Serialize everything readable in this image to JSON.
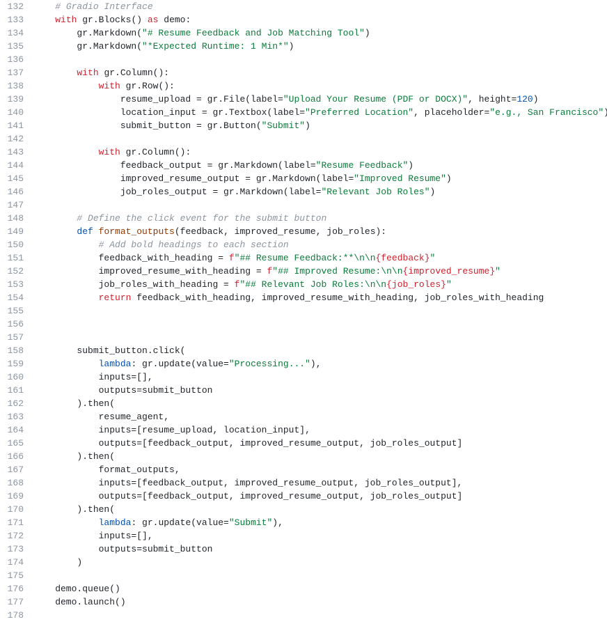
{
  "lines": [
    {
      "n": 132,
      "segs": [
        {
          "t": "    ",
          "k": "op"
        },
        {
          "t": "# Gradio Interface",
          "k": "c"
        }
      ]
    },
    {
      "n": 133,
      "segs": [
        {
          "t": "    ",
          "k": "op"
        },
        {
          "t": "with",
          "k": "kw"
        },
        {
          "t": " gr.Blocks() ",
          "k": "id"
        },
        {
          "t": "as",
          "k": "kw"
        },
        {
          "t": " demo:",
          "k": "id"
        }
      ]
    },
    {
      "n": 134,
      "segs": [
        {
          "t": "        gr.Markdown(",
          "k": "id"
        },
        {
          "t": "\"# Resume Feedback and Job Matching Tool\"",
          "k": "st"
        },
        {
          "t": ")",
          "k": "id"
        }
      ]
    },
    {
      "n": 135,
      "segs": [
        {
          "t": "        gr.Markdown(",
          "k": "id"
        },
        {
          "t": "\"*Expected Runtime: 1 Min*\"",
          "k": "st"
        },
        {
          "t": ")",
          "k": "id"
        }
      ]
    },
    {
      "n": 136,
      "segs": []
    },
    {
      "n": 137,
      "segs": [
        {
          "t": "        ",
          "k": "op"
        },
        {
          "t": "with",
          "k": "kw"
        },
        {
          "t": " gr.Column():",
          "k": "id"
        }
      ]
    },
    {
      "n": 138,
      "segs": [
        {
          "t": "            ",
          "k": "op"
        },
        {
          "t": "with",
          "k": "kw"
        },
        {
          "t": " gr.Row():",
          "k": "id"
        }
      ]
    },
    {
      "n": 139,
      "segs": [
        {
          "t": "                resume_upload = gr.File(label=",
          "k": "id"
        },
        {
          "t": "\"Upload Your Resume (PDF or DOCX)\"",
          "k": "st"
        },
        {
          "t": ", height=",
          "k": "id"
        },
        {
          "t": "120",
          "k": "nm"
        },
        {
          "t": ")",
          "k": "id"
        }
      ]
    },
    {
      "n": 140,
      "segs": [
        {
          "t": "                location_input = gr.Textbox(label=",
          "k": "id"
        },
        {
          "t": "\"Preferred Location\"",
          "k": "st"
        },
        {
          "t": ", placeholder=",
          "k": "id"
        },
        {
          "t": "\"e.g., San Francisco\"",
          "k": "st"
        },
        {
          "t": ")",
          "k": "id"
        }
      ]
    },
    {
      "n": 141,
      "segs": [
        {
          "t": "                submit_button = gr.Button(",
          "k": "id"
        },
        {
          "t": "\"Submit\"",
          "k": "st"
        },
        {
          "t": ")",
          "k": "id"
        }
      ]
    },
    {
      "n": 142,
      "segs": []
    },
    {
      "n": 143,
      "segs": [
        {
          "t": "            ",
          "k": "op"
        },
        {
          "t": "with",
          "k": "kw"
        },
        {
          "t": " gr.Column():",
          "k": "id"
        }
      ]
    },
    {
      "n": 144,
      "segs": [
        {
          "t": "                feedback_output = gr.Markdown(label=",
          "k": "id"
        },
        {
          "t": "\"Resume Feedback\"",
          "k": "st"
        },
        {
          "t": ")",
          "k": "id"
        }
      ]
    },
    {
      "n": 145,
      "segs": [
        {
          "t": "                improved_resume_output = gr.Markdown(label=",
          "k": "id"
        },
        {
          "t": "\"Improved Resume\"",
          "k": "st"
        },
        {
          "t": ")",
          "k": "id"
        }
      ]
    },
    {
      "n": 146,
      "segs": [
        {
          "t": "                job_roles_output = gr.Markdown(label=",
          "k": "id"
        },
        {
          "t": "\"Relevant Job Roles\"",
          "k": "st"
        },
        {
          "t": ")",
          "k": "id"
        }
      ]
    },
    {
      "n": 147,
      "segs": []
    },
    {
      "n": 148,
      "segs": [
        {
          "t": "        ",
          "k": "op"
        },
        {
          "t": "# Define the click event for the submit button",
          "k": "c"
        }
      ]
    },
    {
      "n": 149,
      "segs": [
        {
          "t": "        ",
          "k": "op"
        },
        {
          "t": "def",
          "k": "kw2"
        },
        {
          "t": " ",
          "k": "op"
        },
        {
          "t": "format_outputs",
          "k": "fnd"
        },
        {
          "t": "(feedback, improved_resume, job_roles):",
          "k": "id"
        }
      ]
    },
    {
      "n": 150,
      "segs": [
        {
          "t": "            ",
          "k": "op"
        },
        {
          "t": "# Add bold headings to each section",
          "k": "c"
        }
      ]
    },
    {
      "n": 151,
      "segs": [
        {
          "t": "            feedback_with_heading = ",
          "k": "id"
        },
        {
          "t": "f",
          "k": "kw"
        },
        {
          "t": "\"## Resume Feedback:**\\n\\n",
          "k": "st"
        },
        {
          "t": "{feedback}",
          "k": "sf"
        },
        {
          "t": "\"",
          "k": "st"
        }
      ]
    },
    {
      "n": 152,
      "segs": [
        {
          "t": "            improved_resume_with_heading = ",
          "k": "id"
        },
        {
          "t": "f",
          "k": "kw"
        },
        {
          "t": "\"## Improved Resume:\\n\\n",
          "k": "st"
        },
        {
          "t": "{improved_resume}",
          "k": "sf"
        },
        {
          "t": "\"",
          "k": "st"
        }
      ]
    },
    {
      "n": 153,
      "segs": [
        {
          "t": "            job_roles_with_heading = ",
          "k": "id"
        },
        {
          "t": "f",
          "k": "kw"
        },
        {
          "t": "\"## Relevant Job Roles:\\n\\n",
          "k": "st"
        },
        {
          "t": "{job_roles}",
          "k": "sf"
        },
        {
          "t": "\"",
          "k": "st"
        }
      ]
    },
    {
      "n": 154,
      "segs": [
        {
          "t": "            ",
          "k": "op"
        },
        {
          "t": "return",
          "k": "kw"
        },
        {
          "t": " feedback_with_heading, improved_resume_with_heading, job_roles_with_heading",
          "k": "id"
        }
      ]
    },
    {
      "n": 155,
      "segs": []
    },
    {
      "n": 156,
      "segs": []
    },
    {
      "n": 157,
      "segs": []
    },
    {
      "n": 158,
      "segs": [
        {
          "t": "        submit_button.click(",
          "k": "id"
        }
      ]
    },
    {
      "n": 159,
      "segs": [
        {
          "t": "            ",
          "k": "op"
        },
        {
          "t": "lambda",
          "k": "kw2"
        },
        {
          "t": ": gr.update(value=",
          "k": "id"
        },
        {
          "t": "\"Processing...\"",
          "k": "st"
        },
        {
          "t": "),",
          "k": "id"
        }
      ]
    },
    {
      "n": 160,
      "segs": [
        {
          "t": "            inputs=[],",
          "k": "id"
        }
      ]
    },
    {
      "n": 161,
      "segs": [
        {
          "t": "            outputs=submit_button",
          "k": "id"
        }
      ]
    },
    {
      "n": 162,
      "segs": [
        {
          "t": "        ).then(",
          "k": "id"
        }
      ]
    },
    {
      "n": 163,
      "segs": [
        {
          "t": "            resume_agent,",
          "k": "id"
        }
      ]
    },
    {
      "n": 164,
      "segs": [
        {
          "t": "            inputs=[resume_upload, location_input],",
          "k": "id"
        }
      ]
    },
    {
      "n": 165,
      "segs": [
        {
          "t": "            outputs=[feedback_output, improved_resume_output, job_roles_output]",
          "k": "id"
        }
      ]
    },
    {
      "n": 166,
      "segs": [
        {
          "t": "        ).then(",
          "k": "id"
        }
      ]
    },
    {
      "n": 167,
      "segs": [
        {
          "t": "            format_outputs,",
          "k": "id"
        }
      ]
    },
    {
      "n": 168,
      "segs": [
        {
          "t": "            inputs=[feedback_output, improved_resume_output, job_roles_output],",
          "k": "id"
        }
      ]
    },
    {
      "n": 169,
      "segs": [
        {
          "t": "            outputs=[feedback_output, improved_resume_output, job_roles_output]",
          "k": "id"
        }
      ]
    },
    {
      "n": 170,
      "segs": [
        {
          "t": "        ).then(",
          "k": "id"
        }
      ]
    },
    {
      "n": 171,
      "segs": [
        {
          "t": "            ",
          "k": "op"
        },
        {
          "t": "lambda",
          "k": "kw2"
        },
        {
          "t": ": gr.update(value=",
          "k": "id"
        },
        {
          "t": "\"Submit\"",
          "k": "st"
        },
        {
          "t": "),",
          "k": "id"
        }
      ]
    },
    {
      "n": 172,
      "segs": [
        {
          "t": "            inputs=[],",
          "k": "id"
        }
      ]
    },
    {
      "n": 173,
      "segs": [
        {
          "t": "            outputs=submit_button",
          "k": "id"
        }
      ]
    },
    {
      "n": 174,
      "segs": [
        {
          "t": "        )",
          "k": "id"
        }
      ]
    },
    {
      "n": 175,
      "segs": []
    },
    {
      "n": 176,
      "segs": [
        {
          "t": "    demo.queue()",
          "k": "id"
        }
      ]
    },
    {
      "n": 177,
      "segs": [
        {
          "t": "    demo.launch()",
          "k": "id"
        }
      ]
    },
    {
      "n": 178,
      "segs": []
    }
  ]
}
